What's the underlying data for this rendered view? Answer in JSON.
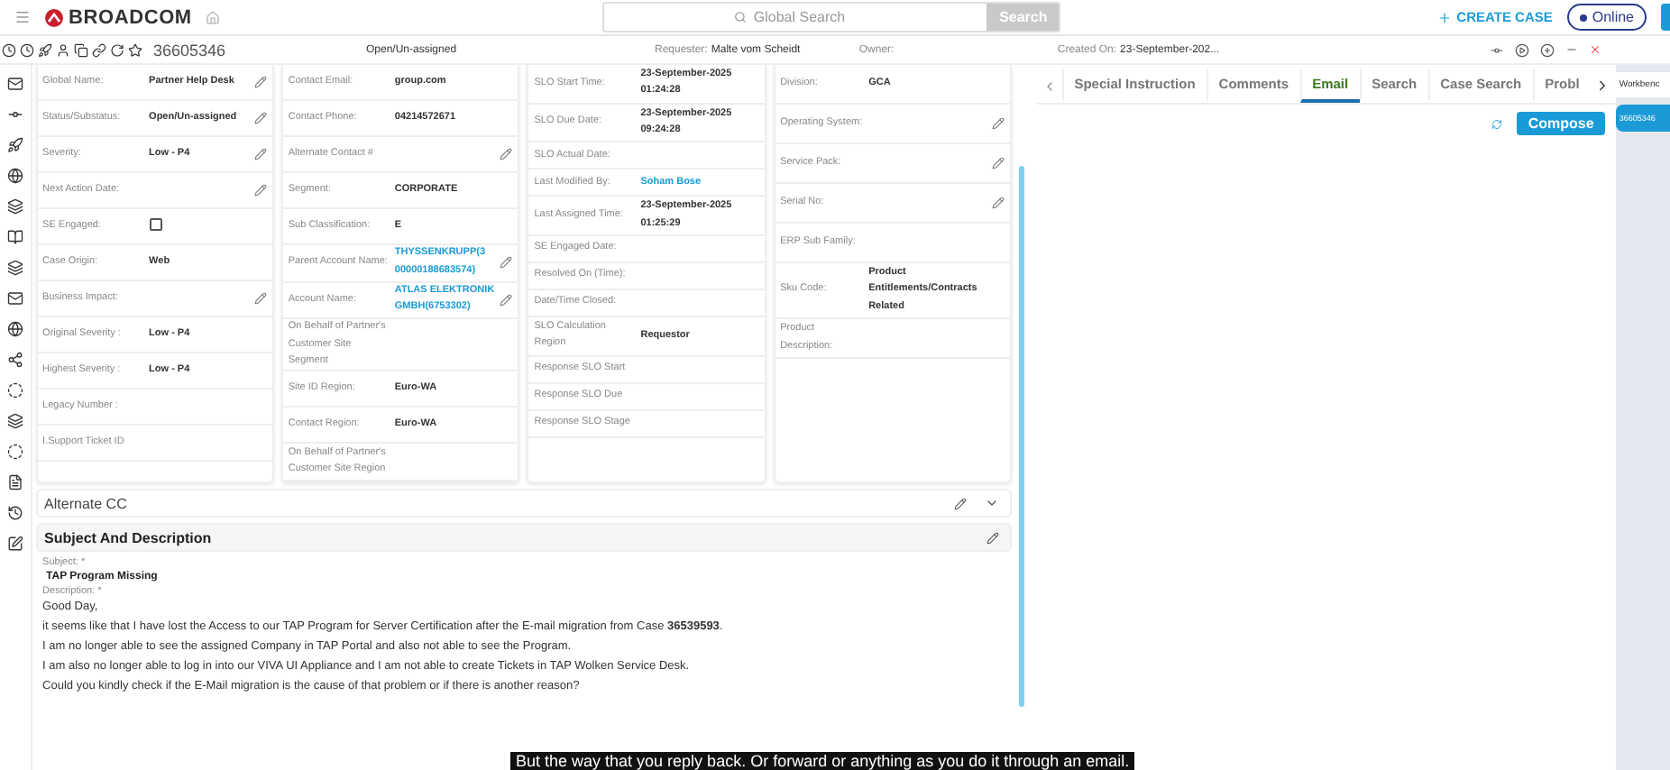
{
  "header": {
    "logo": "BROADCOM",
    "search": {
      "placeholder": "Global Search",
      "button": "Search"
    },
    "create_case": "CREATE CASE",
    "status": {
      "label": "Online",
      "online": true
    }
  },
  "case_bar": {
    "case_number": "36605346",
    "status": "Open/Un-assigned",
    "requester_label": "Requester:",
    "requester": "Malte vom Scheidt",
    "owner_label": "Owner:",
    "created_label": "Created On:",
    "created": "23-September-202..."
  },
  "field_columns": [
    {
      "fields": [
        {
          "label": "Global Name:",
          "value": "Partner Help Desk",
          "kind": "text",
          "editable": true
        },
        {
          "label": "Status/Substatus:",
          "value": "Open/Un-assigned",
          "kind": "text",
          "editable": true
        },
        {
          "label": "Severity:",
          "value": "Low - P4",
          "kind": "text",
          "editable": true
        },
        {
          "label": "Next Action Date:",
          "kind": "text",
          "editable": true
        },
        {
          "label": "SE Engaged:",
          "kind": "checkbox",
          "checked": false,
          "editable": false
        },
        {
          "label": "Case Origin:",
          "value": "Web",
          "kind": "text",
          "editable": false
        },
        {
          "label": "Business Impact:",
          "kind": "text",
          "editable": true
        },
        {
          "label": "Original Severity :",
          "value": "Low - P4",
          "kind": "text",
          "editable": false
        },
        {
          "label": "Highest Severity :",
          "value": "Low - P4",
          "kind": "text",
          "editable": false
        },
        {
          "label": "Legacy Number :",
          "kind": "text",
          "editable": false
        },
        {
          "label": "I.Support Ticket ID",
          "kind": "text",
          "editable": false
        }
      ]
    },
    {
      "fields": [
        {
          "label": "Contact Email:",
          "value": "group.com",
          "kind": "text",
          "editable": false
        },
        {
          "label": "Contact Phone:",
          "value": "04214572671",
          "kind": "text",
          "editable": false
        },
        {
          "label": "Alternate Contact #",
          "kind": "text",
          "editable": true
        },
        {
          "label": "Segment:",
          "value": "CORPORATE",
          "kind": "text",
          "editable": false
        },
        {
          "label": "Sub Classification:",
          "value": "E",
          "kind": "text",
          "editable": false
        },
        {
          "label": "Parent Account Name:",
          "value": "THYSSENKRUPP(3 00000188683574)",
          "kind": "link",
          "editable": true
        },
        {
          "label": "Account Name:",
          "value": "ATLAS ELEKTRONIK GMBH(6753302)",
          "kind": "link",
          "editable": true
        },
        {
          "label": "On Behalf of Partner's Customer Site Segment",
          "kind": "text",
          "editable": false
        },
        {
          "label": "Site ID Region:",
          "value": "Euro-WA",
          "kind": "text",
          "editable": false
        },
        {
          "label": "Contact Region:",
          "value": "Euro-WA",
          "kind": "text",
          "editable": false
        },
        {
          "label": "On Behalf of Partner's Customer Site Region",
          "kind": "text",
          "editable": false
        }
      ]
    },
    {
      "fields": [
        {
          "label": "SLO Start Time:",
          "value": "23-September-2025 01:24:28",
          "kind": "text",
          "editable": false
        },
        {
          "label": "SLO Due Date:",
          "value": "23-September-2025 09:24:28",
          "kind": "text",
          "editable": false
        },
        {
          "label": "SLO Actual Date:",
          "kind": "text",
          "editable": false
        },
        {
          "label": "Last Modified By:",
          "value": "Soham Bose",
          "kind": "link",
          "editable": false
        },
        {
          "label": "Last Assigned Time:",
          "value": "23-September-2025 01:25:29",
          "kind": "text",
          "editable": false
        },
        {
          "label": "SE Engaged Date:",
          "kind": "text",
          "editable": false
        },
        {
          "label": "Resolved On (Time):",
          "kind": "text",
          "editable": false
        },
        {
          "label": "Date/Time Closed:",
          "kind": "text",
          "editable": false
        },
        {
          "label": "SLO Calculation Region",
          "value": "Requestor",
          "kind": "text",
          "editable": false
        },
        {
          "label": "Response SLO Start",
          "kind": "text",
          "editable": false
        },
        {
          "label": "Response SLO Due",
          "kind": "text",
          "editable": false
        },
        {
          "label": "Response SLO Stage",
          "kind": "text",
          "editable": false
        }
      ]
    },
    {
      "fields": [
        {
          "label": "Division:",
          "value": "GCA",
          "kind": "text",
          "editable": false
        },
        {
          "label": "Operating System:",
          "kind": "text",
          "editable": true
        },
        {
          "label": "Service Pack:",
          "kind": "text",
          "editable": true
        },
        {
          "label": "Serial No:",
          "kind": "text",
          "editable": true
        },
        {
          "label": "ERP Sub Family:",
          "kind": "text",
          "editable": false
        },
        {
          "label": "Sku Code:",
          "value": "Product Entitlements/Contracts Related",
          "kind": "text",
          "editable": false
        },
        {
          "label": "Product Description:",
          "kind": "text",
          "editable": false
        }
      ]
    }
  ],
  "alternate_cc": {
    "title": "Alternate CC",
    "expanded": false
  },
  "subject_section": {
    "title": "Subject And Description",
    "subject_label": "Subject: *",
    "subject": "TAP Program Missing",
    "description_label": "Description: *",
    "description": [
      "Good Day,",
      "it seems like that I have lost the Access to our TAP Program for Server Certification after the E-mail migration from Case **36539593**.",
      "I am no longer able to see the assigned Company in TAP Portal and also not able to see the Program.",
      "I am also no longer able to log in into our VIVA UI Appliance and I am not able to create Tickets in TAP Wolken Service Desk.",
      "Could you kindly check if the E-Mail migration is the cause of that problem or if there is another reason?"
    ]
  },
  "tabs": [
    {
      "label": "Special Instruction",
      "selected": false
    },
    {
      "label": "Comments",
      "selected": false
    },
    {
      "label": "Email",
      "selected": true
    },
    {
      "label": "Search",
      "selected": false
    },
    {
      "label": "Case Search",
      "selected": false
    },
    {
      "label": "Probl",
      "selected": false
    }
  ],
  "compose": "Compose",
  "workbench": {
    "title": "Workbenc",
    "items": [
      "36605346"
    ]
  },
  "caption": "But the way that you reply back. Or forward or anything as you do it through an email."
}
